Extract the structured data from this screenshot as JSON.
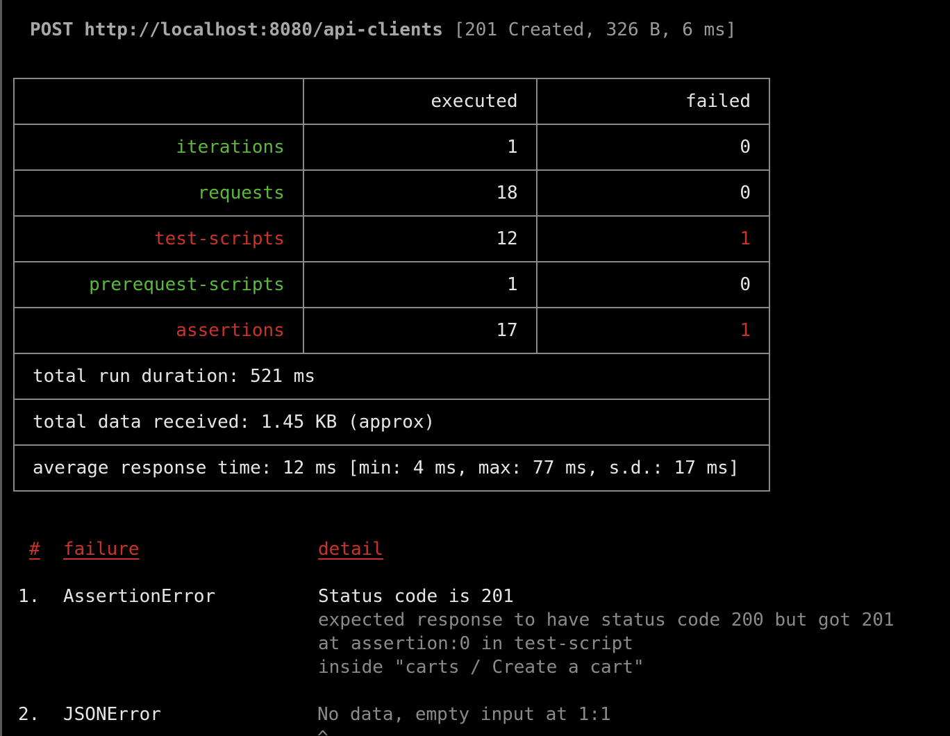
{
  "request": {
    "method": "POST",
    "url": "http://localhost:8080/api-clients",
    "meta": "[201 Created, 326 B, 6 ms]"
  },
  "summary": {
    "headers": {
      "executed": "executed",
      "failed": "failed"
    },
    "rows": [
      {
        "label": "iterations",
        "executed": "1",
        "failed": "0"
      },
      {
        "label": "requests",
        "executed": "18",
        "failed": "0"
      },
      {
        "label": "test-scripts",
        "executed": "12",
        "failed": "1"
      },
      {
        "label": "prerequest-scripts",
        "executed": "1",
        "failed": "0"
      },
      {
        "label": "assertions",
        "executed": "17",
        "failed": "1"
      }
    ],
    "total_run_duration": "total run duration: 521 ms",
    "total_data_received": "total data received: 1.45 KB (approx)",
    "average_response_time": "average response time: 12 ms [min: 4 ms, max: 77 ms, s.d.: 17 ms]"
  },
  "failures": {
    "headers": {
      "number": "#",
      "failure": "failure",
      "detail": "detail"
    },
    "items": [
      {
        "number": "1.",
        "type": "AssertionError",
        "title": "Status code is 201",
        "lines": [
          "expected response to have status code 200 but got 201",
          "at assertion:0 in test-script",
          "inside \"carts / Create a cart\""
        ]
      },
      {
        "number": "2.",
        "type": "JSONError",
        "title": "No data, empty input at 1:1",
        "caret": "^"
      }
    ]
  },
  "colors": {
    "pass": "#5cb83a",
    "fail": "#c9342a",
    "background": "#000000",
    "text": "#e6e6e6",
    "dim": "#8a8a8a"
  }
}
